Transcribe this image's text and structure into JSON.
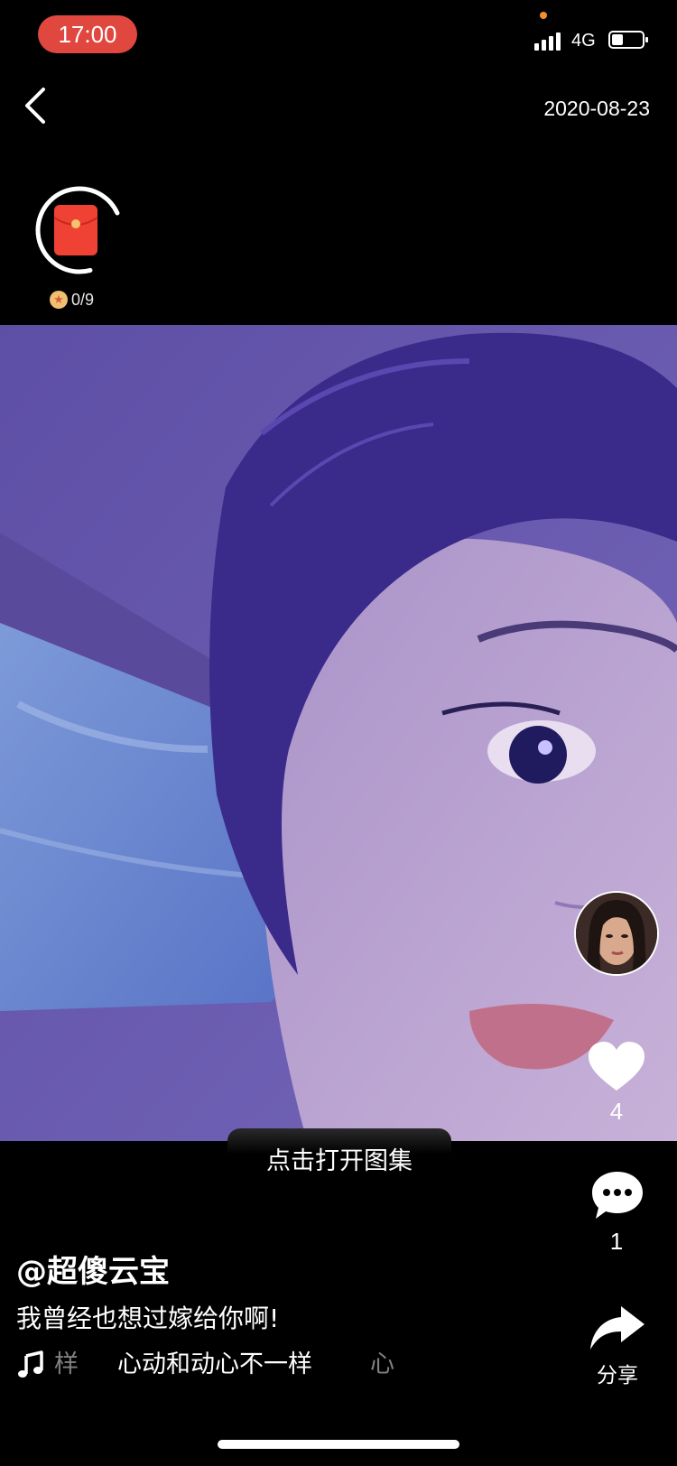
{
  "status_bar": {
    "time": "17:00",
    "network": "4G"
  },
  "header": {
    "date": "2020-08-23"
  },
  "red_packet": {
    "count": "0/9",
    "progress": 0.7
  },
  "gallery": {
    "open_label": "点击打开图集"
  },
  "actions": {
    "like_count": "4",
    "comment_count": "1",
    "share_label": "分享"
  },
  "post": {
    "author": "@超傻云宝",
    "caption": "我曾经也想过嫁给你啊!",
    "music_prev": "样",
    "music_title": "心动和动心不一样",
    "music_next": "心"
  },
  "colors": {
    "time_pill": "#e0473f",
    "red_packet": "#f04234",
    "photo_tint": "#6b5db2"
  },
  "icons": {
    "back": "chevron-left-icon",
    "like": "heart-icon",
    "comment": "speech-bubble-icon",
    "share": "share-arrow-icon",
    "music": "music-note-icon",
    "coin": "star-coin-icon"
  }
}
